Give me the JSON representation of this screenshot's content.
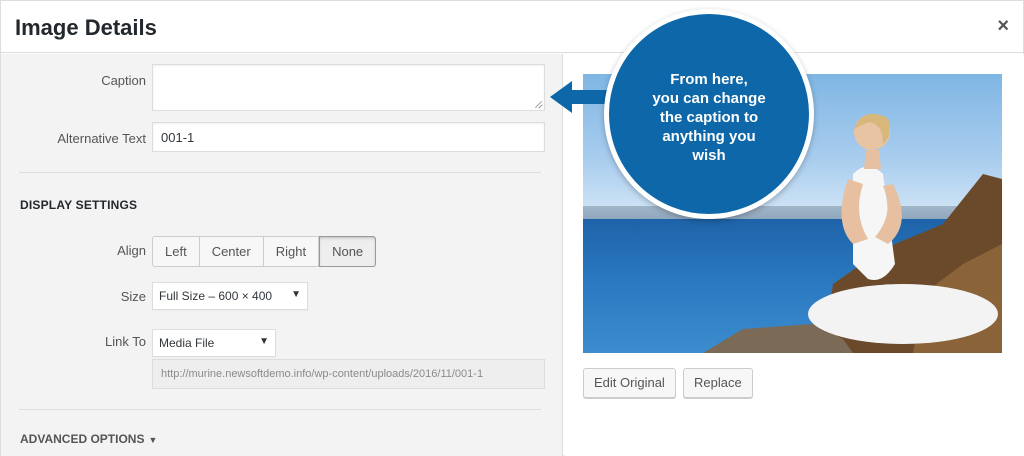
{
  "dialog": {
    "title": "Image Details",
    "close_label": "×"
  },
  "form": {
    "caption_label": "Caption",
    "caption_value": "",
    "alt_label": "Alternative Text",
    "alt_value": "001-1",
    "display_settings_heading": "DISPLAY SETTINGS",
    "align_label": "Align",
    "align_options": [
      "Left",
      "Center",
      "Right",
      "None"
    ],
    "align_selected": "None",
    "size_label": "Size",
    "size_value": "Full Size – 600 × 400",
    "link_label": "Link To",
    "link_value": "Media File",
    "link_url": "http://murine.newsoftdemo.info/wp-content/uploads/2016/11/001-1",
    "advanced_options_label": "ADVANCED OPTIONS"
  },
  "preview": {
    "edit_original_label": "Edit Original",
    "replace_label": "Replace"
  },
  "callout": {
    "lines": [
      "From here,",
      "you can change",
      "the caption to",
      "anything you",
      "wish"
    ],
    "color": "#0d67a8"
  }
}
